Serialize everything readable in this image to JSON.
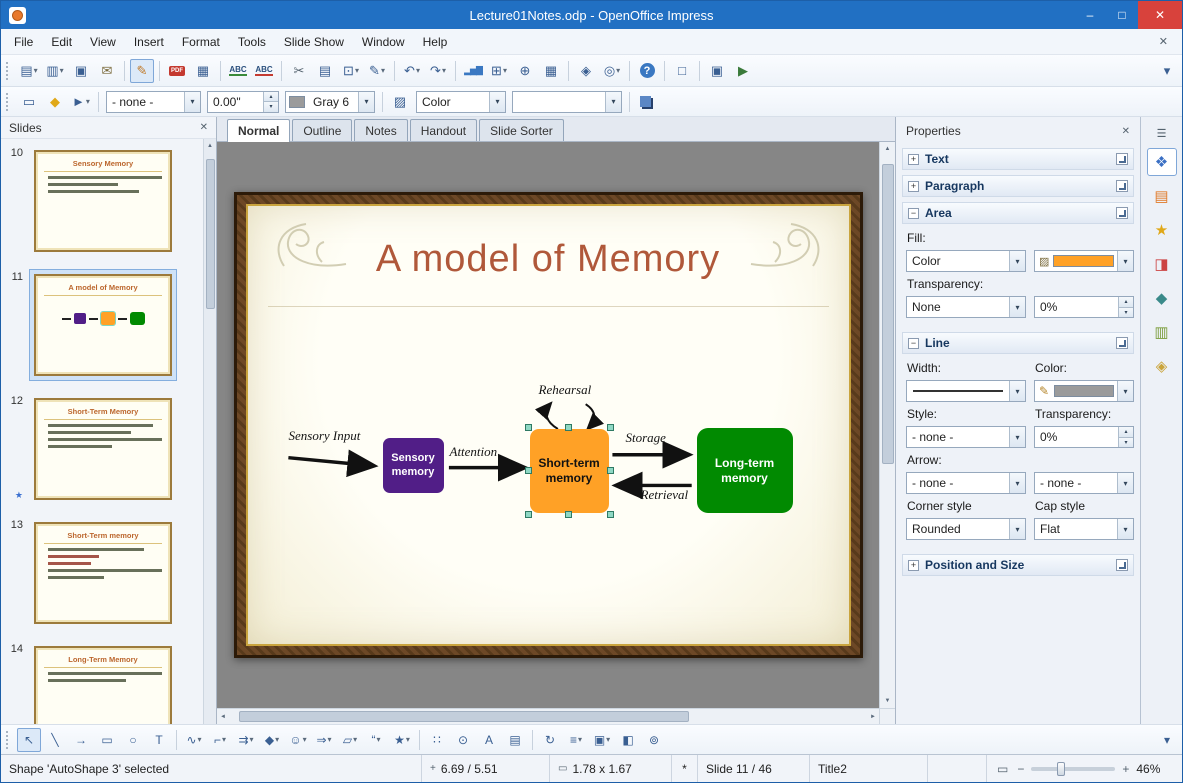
{
  "window": {
    "title": "Lecture01Notes.odp - OpenOffice Impress"
  },
  "window_controls": {
    "minimize": "–",
    "maximize": "□",
    "close": "✕"
  },
  "menubar": {
    "items": [
      "File",
      "Edit",
      "View",
      "Insert",
      "Format",
      "Tools",
      "Slide Show",
      "Window",
      "Help"
    ],
    "close_doc": "✕"
  },
  "line_filling_bar": {
    "line_style": "- none -",
    "line_width": "0.00\"",
    "line_color": "Gray 6",
    "fill_type": "Color",
    "fill_color": ""
  },
  "view_tabs": {
    "items": [
      "Normal",
      "Outline",
      "Notes",
      "Handout",
      "Slide Sorter"
    ],
    "active": "Normal"
  },
  "slides_panel": {
    "title": "Slides",
    "slides": [
      {
        "number": "10",
        "title": "Sensory Memory"
      },
      {
        "number": "11",
        "title": "A model of Memory",
        "selected": true
      },
      {
        "number": "12",
        "title": "Short-Term Memory"
      },
      {
        "number": "13",
        "title": "Short-Term memory"
      },
      {
        "number": "14",
        "title": "Long-Term Memory"
      }
    ]
  },
  "slide": {
    "title": "A model of Memory",
    "labels": {
      "input": "Sensory Input",
      "attention": "Attention",
      "rehearsal": "Rehearsal",
      "storage": "Storage",
      "retrieval": "Retrieval"
    },
    "boxes": {
      "sensory": "Sensory memory",
      "short_term": "Short-term memory",
      "long_term": "Long-term memory"
    },
    "colors": {
      "sensory": "#511e87",
      "short_term": "#ffa126",
      "long_term": "#018a01",
      "title": "#b0583a",
      "selection_handle": "#8fd8c4"
    }
  },
  "properties": {
    "title": "Properties",
    "sections": {
      "text": "Text",
      "paragraph": "Paragraph",
      "area": "Area",
      "line": "Line",
      "possize": "Position and Size"
    },
    "area": {
      "fill_label": "Fill:",
      "fill_type": "Color",
      "fill_color": "#ff9a26",
      "transparency_label": "Transparency:",
      "transparency_mode": "None",
      "transparency_value": "0%"
    },
    "line": {
      "width_label": "Width:",
      "color_label": "Color:",
      "color_value": "#9b9b9b",
      "style_label": "Style:",
      "style_value": "- none -",
      "transparency_label": "Transparency:",
      "transparency_value": "0%",
      "arrow_label": "Arrow:",
      "arrow_start": "- none -",
      "arrow_end": "- none -",
      "corner_label": "Corner style",
      "corner_value": "Rounded",
      "cap_label": "Cap style",
      "cap_value": "Flat"
    }
  },
  "statusbar": {
    "selection": "Shape 'AutoShape 3' selected",
    "position": "6.69 / 5.51",
    "size": "1.78 x 1.67",
    "modified": "*",
    "slide": "Slide 11 / 46",
    "layout": "Title2",
    "zoom": "46%"
  },
  "icons": {
    "new_doc": "▤",
    "open": "▥",
    "save": "▣",
    "email": "✉",
    "edit": "✎",
    "pdf": "PDF",
    "print": "▦",
    "spell": "ABC",
    "autospell": "ABC",
    "cut": "✂",
    "copy": "▤",
    "paste": "⊡",
    "clone": "✎",
    "undo": "↶",
    "redo": "↷",
    "chart": "▂▅▇",
    "table": "⊞",
    "hyperlink": "⊕",
    "grid": "▦",
    "navigator": "◈",
    "zoom": "◎",
    "help": "?",
    "new_slide": "□",
    "slide_design": "▣",
    "slide_show": "▶",
    "overflow": "▾",
    "page": "▭",
    "fill_tool": "◆",
    "arrow_style": "►",
    "bucket": "▨",
    "pencil": "✎",
    "select": "↖",
    "line": "╲",
    "arrow_r": "→",
    "rect": "▭",
    "ellipse": "○",
    "text": "T",
    "curve": "∿",
    "connector": "⌐",
    "lines_arrows": "⇉",
    "basic_shapes": "◆",
    "symbol_shapes": "☺",
    "block_arrows": "⇒",
    "flowchart": "▱",
    "callouts": "“",
    "stars": "★",
    "points": "∷",
    "glue": "⊙",
    "fontwork": "A",
    "image": "▤",
    "rotate": "↻",
    "align": "≡",
    "arrange": "▣",
    "extrusion": "◧",
    "interaction": "⊚",
    "sb_settings": "☰",
    "sb_properties": "❖",
    "sb_master": "▤",
    "sb_anim": "★",
    "sb_trans": "◨",
    "sb_gallery": "▥",
    "sb_styles": "◆",
    "sb_nav": "◈",
    "pos": "+",
    "size_i": "▭",
    "zoom_fit": "▭",
    "minus": "−",
    "plus": "+",
    "up": "▲",
    "down": "▼",
    "left": "◄",
    "right": "►",
    "spin_up": "▴",
    "spin_down": "▾",
    "caret": "▾",
    "expand": "+",
    "collapse": "−",
    "close": "✕",
    "transition_star": "★"
  }
}
